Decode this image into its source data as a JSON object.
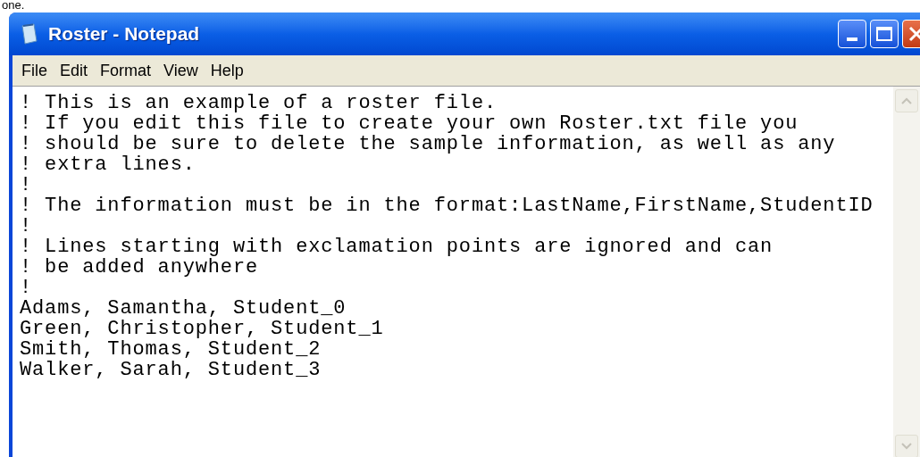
{
  "page_text": "one.",
  "window": {
    "title": "Roster - Notepad"
  },
  "menu": [
    "File",
    "Edit",
    "Format",
    "View",
    "Help"
  ],
  "editor": {
    "lines": [
      "! This is an example of a roster file.",
      "! If you edit this file to create your own Roster.txt file you",
      "! should be sure to delete the sample information, as well as any",
      "! extra lines.",
      "!",
      "! The information must be in the format:LastName,FirstName,StudentID",
      "!",
      "! Lines starting with exclamation points are ignored and can",
      "! be added anywhere",
      "!",
      "Adams, Samantha, Student_0",
      "Green, Christopher, Student_1",
      "Smith, Thomas, Student_2",
      "Walker, Sarah, Student_3"
    ]
  }
}
